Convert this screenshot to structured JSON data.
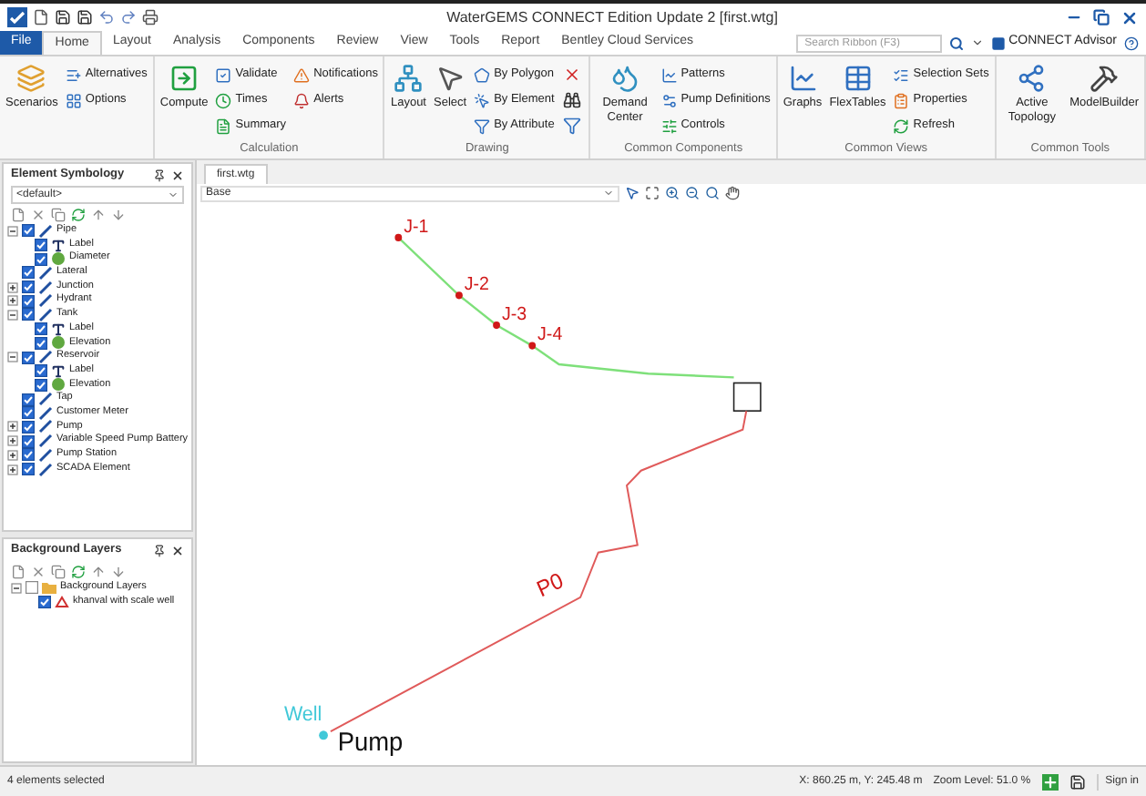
{
  "window": {
    "title": "WaterGEMS CONNECT Edition Update 2 [first.wtg]"
  },
  "menu_tabs": [
    {
      "label": "File",
      "kind": "file",
      "selected": false
    },
    {
      "label": "Home",
      "kind": "tab",
      "selected": true
    },
    {
      "label": "Layout",
      "kind": "tab",
      "selected": false
    },
    {
      "label": "Analysis",
      "kind": "tab",
      "selected": false
    },
    {
      "label": "Components",
      "kind": "tab",
      "selected": false
    },
    {
      "label": "Review",
      "kind": "tab",
      "selected": false
    },
    {
      "label": "View",
      "kind": "tab",
      "selected": false
    },
    {
      "label": "Tools",
      "kind": "tab",
      "selected": false
    },
    {
      "label": "Report",
      "kind": "tab",
      "selected": false
    },
    {
      "label": "Bentley Cloud Services",
      "kind": "tab",
      "selected": false
    }
  ],
  "search": {
    "placeholder": "Search Ribbon (F3)"
  },
  "advisor": {
    "label": "CONNECT Advisor"
  },
  "ribbon_groups": [
    {
      "items": [
        {
          "label": "Scenarios",
          "kind": "large"
        },
        {
          "label": "Alternatives",
          "kind": "small"
        },
        {
          "label": "Options",
          "kind": "small"
        }
      ]
    },
    {
      "label": "Calculation",
      "items": [
        {
          "label": "Compute",
          "kind": "large"
        },
        {
          "label": "Validate",
          "kind": "small"
        },
        {
          "label": "Times",
          "kind": "small"
        },
        {
          "label": "Summary",
          "kind": "small"
        },
        {
          "label": "Notifications",
          "kind": "small"
        },
        {
          "label": "Alerts",
          "kind": "small"
        }
      ]
    },
    {
      "label": "Drawing",
      "items": [
        {
          "label": "Layout",
          "kind": "large"
        },
        {
          "label": "Select",
          "kind": "large"
        },
        {
          "label": "By Polygon",
          "kind": "small"
        },
        {
          "label": "By Element",
          "kind": "small"
        },
        {
          "label": "By Attribute",
          "kind": "small"
        },
        {
          "kind": "icon"
        },
        {
          "kind": "icon"
        },
        {
          "kind": "icon"
        }
      ]
    },
    {
      "label": "Common Components",
      "items": [
        {
          "label": "Demand Center",
          "kind": "large"
        },
        {
          "label": "Patterns",
          "kind": "small"
        },
        {
          "label": "Pump Definitions",
          "kind": "small"
        },
        {
          "label": "Controls",
          "kind": "small"
        }
      ]
    },
    {
      "label": "Common Views",
      "items": [
        {
          "label": "Graphs",
          "kind": "large"
        },
        {
          "label": "FlexTables",
          "kind": "large"
        },
        {
          "label": "Selection Sets",
          "kind": "small"
        },
        {
          "label": "Properties",
          "kind": "small"
        },
        {
          "label": "Refresh",
          "kind": "small"
        }
      ]
    },
    {
      "label": "Common Tools",
      "items": [
        {
          "label": "Active Topology",
          "kind": "large"
        },
        {
          "label": "ModelBuilder",
          "kind": "large"
        }
      ]
    }
  ],
  "element_symbology": {
    "title": "Element Symbology",
    "dropdown": "<default>",
    "tree": [
      {
        "label": "Pipe",
        "kind": "element",
        "checked": true,
        "expanded": true,
        "children": [
          {
            "label": "Label",
            "kind": "label",
            "checked": true
          },
          {
            "label": "Diameter",
            "kind": "field",
            "checked": true
          }
        ]
      },
      {
        "label": "Lateral",
        "kind": "element",
        "checked": true
      },
      {
        "label": "Junction",
        "kind": "element",
        "checked": true,
        "expanded": false
      },
      {
        "label": "Hydrant",
        "kind": "element",
        "checked": true,
        "expanded": false
      },
      {
        "label": "Tank",
        "kind": "element",
        "checked": true,
        "expanded": true,
        "children": [
          {
            "label": "Label",
            "kind": "label",
            "checked": true
          },
          {
            "label": "Elevation",
            "kind": "field",
            "checked": true
          }
        ]
      },
      {
        "label": "Reservoir",
        "kind": "element",
        "checked": true,
        "expanded": true,
        "children": [
          {
            "label": "Label",
            "kind": "label",
            "checked": true
          },
          {
            "label": "Elevation",
            "kind": "field",
            "checked": true
          }
        ]
      },
      {
        "label": "Tap",
        "kind": "element",
        "checked": true
      },
      {
        "label": "Customer Meter",
        "kind": "element",
        "checked": true
      },
      {
        "label": "Pump",
        "kind": "element",
        "checked": true,
        "expanded": false
      },
      {
        "label": "Variable Speed Pump Battery",
        "kind": "element",
        "checked": true,
        "expanded": false
      },
      {
        "label": "Pump Station",
        "kind": "element",
        "checked": true,
        "expanded": false
      },
      {
        "label": "SCADA Element",
        "kind": "element",
        "checked": true,
        "expanded": false
      }
    ]
  },
  "background_layers": {
    "title": "Background Layers",
    "tree": [
      {
        "label": "Background Layers",
        "kind": "layer-group",
        "checked": false,
        "expanded": true,
        "children": [
          {
            "label": "khanval with scale well",
            "kind": "layer",
            "checked": true
          }
        ]
      }
    ]
  },
  "document_tab": {
    "label": "first.wtg"
  },
  "view_dropdown": "Base",
  "network": {
    "junctions": [
      "J-1",
      "J-2",
      "J-3",
      "J-4"
    ],
    "pipe_label": "P0",
    "well_label": "Well",
    "pump_label": "Pump"
  },
  "status_bar": {
    "selection": "4 elements selected",
    "coordinates": "X: 860.25 m, Y: 245.48 m",
    "zoom": "Zoom Level: 51.0 %",
    "sign_in": "Sign in"
  }
}
